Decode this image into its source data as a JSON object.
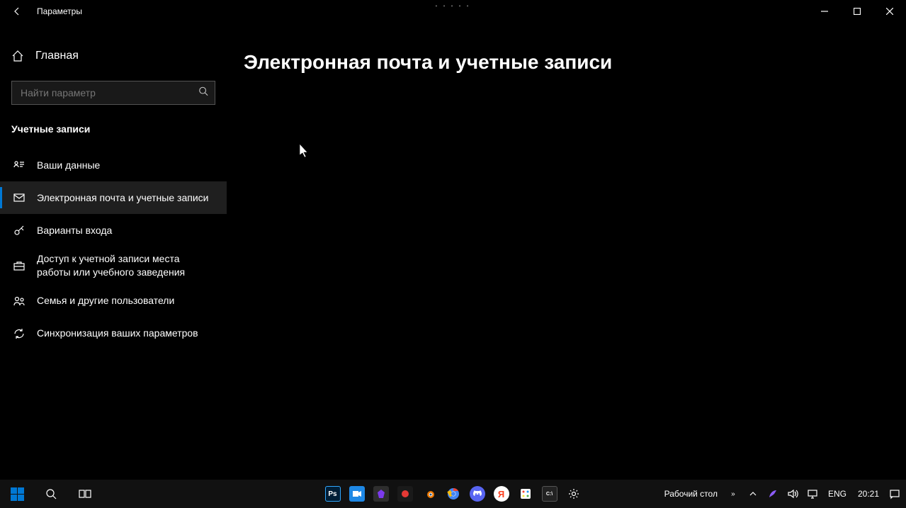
{
  "titlebar": {
    "title": "Параметры"
  },
  "sidebar": {
    "home": "Главная",
    "search_placeholder": "Найти параметр",
    "category": "Учетные записи",
    "items": [
      {
        "label": "Ваши данные"
      },
      {
        "label": "Электронная почта и учетные записи"
      },
      {
        "label": "Варианты входа"
      },
      {
        "label": "Доступ к учетной записи места работы или учебного заведения"
      },
      {
        "label": "Семья и другие пользователи"
      },
      {
        "label": "Синхронизация ваших параметров"
      }
    ]
  },
  "main": {
    "title": "Электронная почта и учетные записи"
  },
  "taskbar": {
    "desktop_label": "Рабочий стол",
    "lang": "ENG",
    "clock": "20:21"
  }
}
